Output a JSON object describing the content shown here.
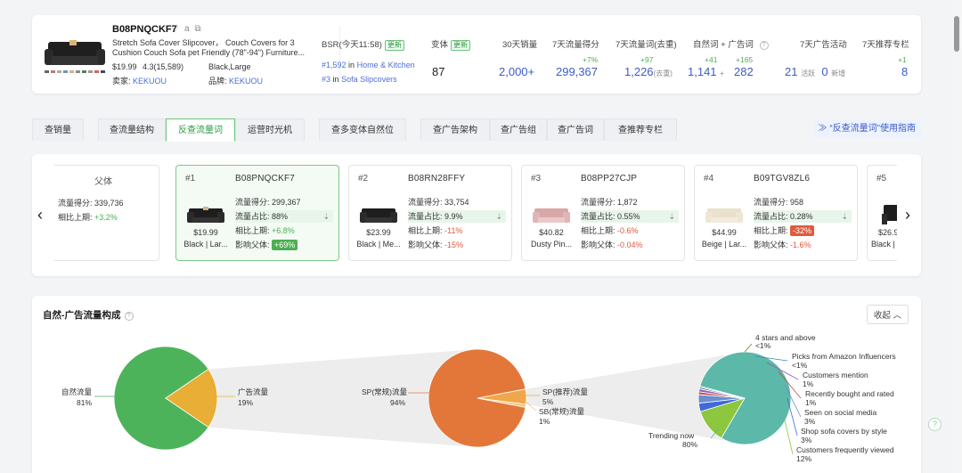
{
  "product": {
    "asin": "B08PNQCKF7",
    "title_lines": [
      "Stretch Sofa Cover Slipcover， Couch Covers for 3",
      "Cushion Couch Sofa pet Friendly (78\"-94\") Furniture..."
    ],
    "price": "$19.99",
    "rating": "4.3(15,589)",
    "variant": "Black,Large",
    "seller_label": "卖家:",
    "seller": "KEKUOU",
    "brand_label": "品牌:",
    "brand": "KEKUOU"
  },
  "metrics": {
    "bsr_label": "BSR(今天11:58)",
    "update_badge": "更新",
    "bsr_rank1": "#1,592",
    "bsr_in": "in",
    "bsr_cat1": "Home & Kitchen",
    "bsr_rank2": "#3",
    "bsr_cat2": "Sofa Slipcovers",
    "variants_label": "变体",
    "variants_value": "87",
    "sales30_label": "30天销量",
    "sales30_value": "2,000+",
    "traffic7_label": "7天流量得分",
    "traffic7_delta": "+7%",
    "traffic7_value": "299,367",
    "kw7_label": "7天流量词(去重)",
    "kw7_delta": "+97",
    "kw7_value": "1,226",
    "kw7_note": "(去重)",
    "organic_label": "自然词",
    "plus": "+",
    "ad_label": "广告词",
    "organic_delta": "+41",
    "ad_delta": "+165",
    "organic_value": "1,141",
    "ad_value": "282",
    "adact_label": "7天广告活动",
    "adact_active": "21",
    "adact_active_label": "活跃",
    "adact_new": "0",
    "adact_new_label": "新增",
    "rec_label": "7天推荐专栏",
    "rec_delta": "+1",
    "rec_value": "8"
  },
  "tabs": [
    "查销量",
    "查流量结构",
    "反查流量词",
    "运营时光机",
    "查多变体自然位",
    "查广告架构",
    "查广告组",
    "查广告词",
    "查推荐专栏"
  ],
  "guide": "“反查流量词”使用指南",
  "parent": {
    "label": "父体",
    "score_label": "流量得分:",
    "score": "339,736",
    "prev_label": "相比上期:",
    "prev": "+3.2%"
  },
  "variants": [
    {
      "rank": "#1",
      "asin": "B08PNQCKF7",
      "price": "$19.99",
      "color": "Black | Lar...",
      "score_label": "流量得分:",
      "score": "299,367",
      "share_label": "流量占比:",
      "share": "88%",
      "prev_label": "相比上期:",
      "prev": "+6.8%",
      "impact_label": "影响父体:",
      "impact": "+69%"
    },
    {
      "rank": "#2",
      "asin": "B08RN28FFY",
      "price": "$23.99",
      "color": "Black | Me...",
      "score_label": "流量得分:",
      "score": "33,754",
      "share_label": "流量占比:",
      "share": "9.9%",
      "prev_label": "相比上期:",
      "prev": "-11%",
      "impact_label": "影响父体:",
      "impact": "-15%"
    },
    {
      "rank": "#3",
      "asin": "B08PP27CJP",
      "price": "$40.82",
      "color": "Dusty Pin...",
      "score_label": "流量得分:",
      "score": "1,872",
      "share_label": "流量占比:",
      "share": "0.55%",
      "prev_label": "相比上期:",
      "prev": "-0.6%",
      "impact_label": "影响父体:",
      "impact": "-0.04%"
    },
    {
      "rank": "#4",
      "asin": "B09TGV8ZL6",
      "price": "$44.99",
      "color": "Beige | Lar...",
      "score_label": "流量得分:",
      "score": "958",
      "share_label": "流量占比:",
      "share": "0.28%",
      "prev_label": "相比上期:",
      "prev": "-32%",
      "impact_label": "影响父体:",
      "impact": "-1.6%"
    },
    {
      "rank": "#5",
      "asin": "",
      "price": "$26.9",
      "color": "Black |",
      "score_label": "",
      "score": "",
      "share_label": "",
      "share": "",
      "prev_label": "",
      "prev": "",
      "impact_label": "",
      "impact": ""
    }
  ],
  "pie_section": {
    "title": "自然-广告流量构成",
    "collapse": "收起"
  },
  "colors": {
    "green": "#4caf50",
    "orange": "#e0a83a",
    "sp": "#e3773a",
    "teal": "#5cb8a8",
    "accent": "#3c5cc7"
  },
  "chart_data": [
    {
      "type": "pie",
      "slices": [
        {
          "label": "自然流量",
          "value": 81,
          "display": "81%",
          "color": "#4cb35a"
        },
        {
          "label": "广告流量",
          "value": 19,
          "display": "19%",
          "color": "#e8ae35"
        }
      ]
    },
    {
      "type": "pie",
      "slices": [
        {
          "label": "SP(常规)流量",
          "value": 94,
          "display": "94%",
          "color": "#e3773a"
        },
        {
          "label": "SP(推荐)流量",
          "value": 5,
          "display": "5%",
          "color": "#f0a64a"
        },
        {
          "label": "SB(常规)流量",
          "value": 1,
          "display": "1%",
          "color": "#f6c36e"
        }
      ]
    },
    {
      "type": "pie",
      "slices": [
        {
          "label": "Trending now",
          "value": 80,
          "display": "80%",
          "color": "#5cb8a8"
        },
        {
          "label": "Customers frequently viewed",
          "value": 12,
          "display": "12%",
          "color": "#8dc63f"
        },
        {
          "label": "Shop sofa covers by style",
          "value": 3,
          "display": "3%",
          "color": "#3f6ad8"
        },
        {
          "label": "Seen on social media",
          "value": 3,
          "display": "3%",
          "color": "#6a8fd0"
        },
        {
          "label": "Recently bought and rated",
          "value": 1,
          "display": "1%",
          "color": "#c0504d"
        },
        {
          "label": "Customers mention",
          "value": 1,
          "display": "1%",
          "color": "#9b59b6"
        },
        {
          "label": "Picks from Amazon Influencers",
          "value": 0.6,
          "display": "<1%",
          "color": "#2e8bc0"
        },
        {
          "label": "4 stars and above",
          "value": 0.4,
          "display": "<1%",
          "color": "#8a6d3b"
        }
      ]
    }
  ]
}
